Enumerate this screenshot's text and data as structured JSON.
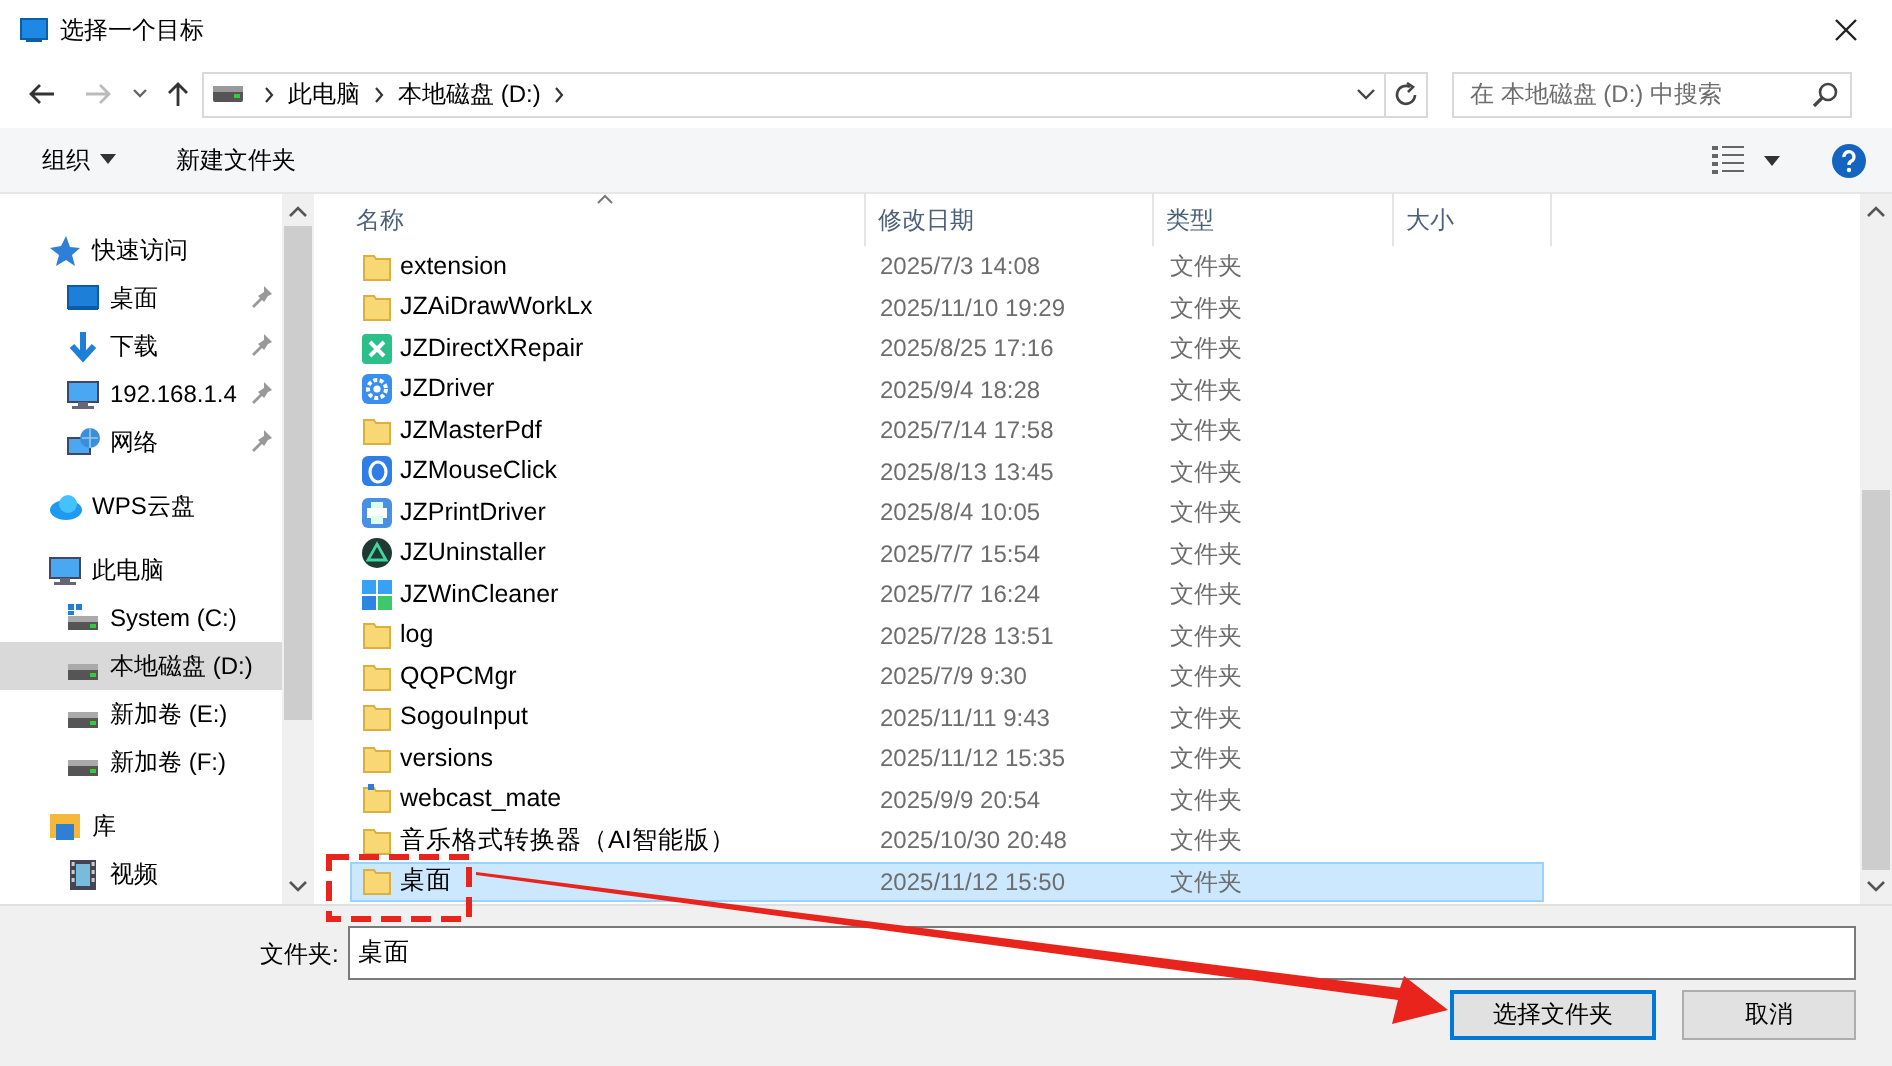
{
  "window": {
    "title": "选择一个目标"
  },
  "address": {
    "crumbs": [
      "此电脑",
      "本地磁盘 (D:)"
    ]
  },
  "search": {
    "placeholder": "在 本地磁盘 (D:) 中搜索"
  },
  "toolbar": {
    "organize": "组织",
    "new_folder": "新建文件夹"
  },
  "sidebar": {
    "items": [
      {
        "label": "快速访问",
        "kind": "star",
        "selected": false,
        "children": [
          {
            "label": "桌面",
            "kind": "desktop",
            "pinned": true,
            "selected": false
          },
          {
            "label": "下载",
            "kind": "download",
            "pinned": true,
            "selected": false
          },
          {
            "label": "192.168.1.4",
            "kind": "computer",
            "pinned": true,
            "selected": false
          },
          {
            "label": "网络",
            "kind": "network",
            "pinned": true,
            "selected": false
          }
        ]
      },
      {
        "label": "WPS云盘",
        "kind": "cloud",
        "selected": false
      },
      {
        "label": "此电脑",
        "kind": "computer",
        "selected": false,
        "children": [
          {
            "label": "System (C:)",
            "kind": "system-drive",
            "selected": false
          },
          {
            "label": "本地磁盘 (D:)",
            "kind": "drive",
            "selected": true
          },
          {
            "label": "新加卷 (E:)",
            "kind": "drive",
            "selected": false
          },
          {
            "label": "新加卷 (F:)",
            "kind": "drive",
            "selected": false
          }
        ]
      },
      {
        "label": "库",
        "kind": "library",
        "selected": false,
        "children": [
          {
            "label": "视频",
            "kind": "video",
            "selected": false
          }
        ]
      }
    ]
  },
  "table": {
    "columns": [
      {
        "label": "名称",
        "sorted": true
      },
      {
        "label": "修改日期",
        "sorted": false
      },
      {
        "label": "类型",
        "sorted": false
      },
      {
        "label": "大小",
        "sorted": false
      }
    ],
    "rows": [
      {
        "name": "extension",
        "date": "2025/7/3 14:08",
        "type": "文件夹",
        "kind": "folder",
        "selected": false
      },
      {
        "name": "JZAiDrawWorkLx",
        "date": "2025/11/10 19:29",
        "type": "文件夹",
        "kind": "folder",
        "selected": false
      },
      {
        "name": "JZDirectXRepair",
        "date": "2025/8/25 17:16",
        "type": "文件夹",
        "kind": "tools",
        "selected": false
      },
      {
        "name": "JZDriver",
        "date": "2025/9/4 18:28",
        "type": "文件夹",
        "kind": "gear",
        "selected": false
      },
      {
        "name": "JZMasterPdf",
        "date": "2025/7/14 17:58",
        "type": "文件夹",
        "kind": "folder",
        "selected": false
      },
      {
        "name": "JZMouseClick",
        "date": "2025/8/13 13:45",
        "type": "文件夹",
        "kind": "mouse",
        "selected": false
      },
      {
        "name": "JZPrintDriver",
        "date": "2025/8/4 10:05",
        "type": "文件夹",
        "kind": "printer",
        "selected": false
      },
      {
        "name": "JZUninstaller",
        "date": "2025/7/7 15:54",
        "type": "文件夹",
        "kind": "recycle",
        "selected": false
      },
      {
        "name": "JZWinCleaner",
        "date": "2025/7/7 16:24",
        "type": "文件夹",
        "kind": "windows",
        "selected": false
      },
      {
        "name": "log",
        "date": "2025/7/28 13:51",
        "type": "文件夹",
        "kind": "folder",
        "selected": false
      },
      {
        "name": "QQPCMgr",
        "date": "2025/7/9 9:30",
        "type": "文件夹",
        "kind": "folder",
        "selected": false
      },
      {
        "name": "SogouInput",
        "date": "2025/11/11 9:43",
        "type": "文件夹",
        "kind": "folder",
        "selected": false
      },
      {
        "name": "versions",
        "date": "2025/11/12 15:35",
        "type": "文件夹",
        "kind": "folder",
        "selected": false
      },
      {
        "name": "webcast_mate",
        "date": "2025/9/9 20:54",
        "type": "文件夹",
        "kind": "file",
        "selected": false
      },
      {
        "name": "音乐格式转换器（AI智能版）",
        "date": "2025/10/30 20:48",
        "type": "文件夹",
        "kind": "folder",
        "selected": false
      },
      {
        "name": "桌面",
        "date": "2025/11/12 15:50",
        "type": "文件夹",
        "kind": "folder",
        "selected": true
      }
    ]
  },
  "footer": {
    "label": "文件夹:",
    "value": "桌面",
    "buttons": [
      {
        "label": "选择文件夹",
        "default": true
      },
      {
        "label": "取消",
        "default": false
      }
    ]
  },
  "annotations": [
    {
      "kind": "dashed-box"
    },
    {
      "kind": "arrow"
    }
  ]
}
